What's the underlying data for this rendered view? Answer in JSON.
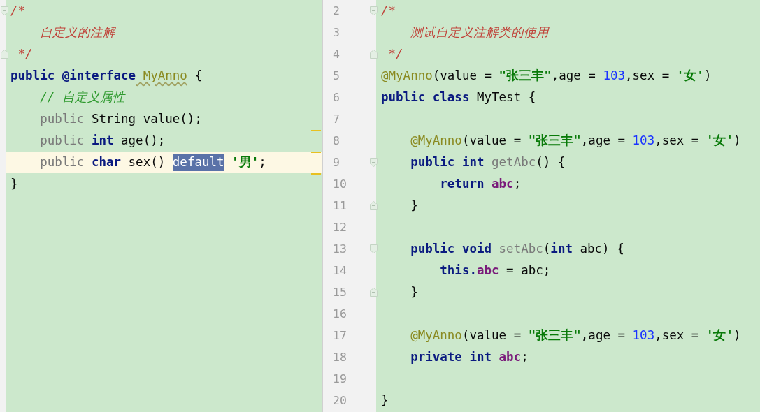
{
  "panes": [
    {
      "lines": [
        {
          "fold_start": true,
          "fold_end": false,
          "marker": false,
          "current": false,
          "tokens": [
            {
              "kind": "comment",
              "t": "/*"
            }
          ]
        },
        {
          "fold_start": false,
          "fold_end": false,
          "marker": false,
          "current": false,
          "tokens": [
            {
              "kind": "comment",
              "t": "    自定义的注解"
            }
          ]
        },
        {
          "fold_start": false,
          "fold_end": true,
          "marker": false,
          "current": false,
          "tokens": [
            {
              "kind": "comment",
              "t": " */"
            }
          ]
        },
        {
          "fold_start": false,
          "fold_end": false,
          "marker": false,
          "current": false,
          "tokens": [
            {
              "kind": "keyword",
              "t": "public"
            },
            {
              "kind": "keyword",
              "t": " @interface"
            },
            {
              "kind": "declared",
              "t": " MyAnno"
            },
            {
              "kind": "plain",
              "t": " {"
            }
          ]
        },
        {
          "fold_start": false,
          "fold_end": false,
          "marker": false,
          "current": false,
          "tokens": [
            {
              "kind": "line-comment",
              "t": "    // 自定义属性"
            }
          ]
        },
        {
          "fold_start": false,
          "fold_end": false,
          "marker": true,
          "current": false,
          "tokens": [
            {
              "kind": "dim",
              "t": "    public"
            },
            {
              "kind": "plain",
              "t": " String value();"
            }
          ]
        },
        {
          "fold_start": false,
          "fold_end": false,
          "marker": true,
          "current": false,
          "tokens": [
            {
              "kind": "dim",
              "t": "    public"
            },
            {
              "kind": "keyword",
              "t": " int"
            },
            {
              "kind": "plain",
              "t": " age();"
            }
          ]
        },
        {
          "fold_start": false,
          "fold_end": false,
          "marker": true,
          "current": true,
          "tokens": [
            {
              "kind": "dim",
              "t": "    public"
            },
            {
              "kind": "keyword",
              "t": " char"
            },
            {
              "kind": "plain",
              "t": " sex() "
            },
            {
              "kind": "selection",
              "t": "default"
            },
            {
              "kind": "string",
              "t": " '男'"
            },
            {
              "kind": "plain",
              "t": ";"
            }
          ]
        },
        {
          "fold_start": false,
          "fold_end": false,
          "marker": false,
          "current": false,
          "tokens": [
            {
              "kind": "plain",
              "t": "}"
            }
          ]
        }
      ]
    },
    {
      "lines": [
        {
          "number": "2",
          "fold_start": true,
          "fold_end": false,
          "tokens": [
            {
              "kind": "comment",
              "t": "/*"
            }
          ]
        },
        {
          "number": "3",
          "fold_start": false,
          "fold_end": false,
          "tokens": [
            {
              "kind": "comment",
              "t": "    测试自定义注解类的使用"
            }
          ]
        },
        {
          "number": "4",
          "fold_start": false,
          "fold_end": true,
          "tokens": [
            {
              "kind": "comment",
              "t": " */"
            }
          ]
        },
        {
          "number": "5",
          "fold_start": false,
          "fold_end": false,
          "tokens": [
            {
              "kind": "annotation",
              "t": "@MyAnno"
            },
            {
              "kind": "plain",
              "t": "(value = "
            },
            {
              "kind": "string",
              "t": "\"张三丰\""
            },
            {
              "kind": "plain",
              "t": ",age = "
            },
            {
              "kind": "number",
              "t": "103"
            },
            {
              "kind": "plain",
              "t": ",sex = "
            },
            {
              "kind": "string",
              "t": "'女'"
            },
            {
              "kind": "plain",
              "t": ")"
            }
          ]
        },
        {
          "number": "6",
          "fold_start": false,
          "fold_end": false,
          "tokens": [
            {
              "kind": "keyword",
              "t": "public class"
            },
            {
              "kind": "plain",
              "t": " MyTest {"
            }
          ]
        },
        {
          "number": "7",
          "fold_start": false,
          "fold_end": false
        },
        {
          "number": "8",
          "fold_start": false,
          "fold_end": false,
          "tokens": [
            {
              "kind": "annotation",
              "t": "    @MyAnno"
            },
            {
              "kind": "plain",
              "t": "(value = "
            },
            {
              "kind": "string",
              "t": "\"张三丰\""
            },
            {
              "kind": "plain",
              "t": ",age = "
            },
            {
              "kind": "number",
              "t": "103"
            },
            {
              "kind": "plain",
              "t": ",sex = "
            },
            {
              "kind": "string",
              "t": "'女'"
            },
            {
              "kind": "plain",
              "t": ")"
            }
          ]
        },
        {
          "number": "9",
          "fold_start": true,
          "fold_end": false,
          "tokens": [
            {
              "kind": "keyword",
              "t": "    public int"
            },
            {
              "kind": "dim",
              "t": " getAbc"
            },
            {
              "kind": "plain",
              "t": "() {"
            }
          ]
        },
        {
          "number": "10",
          "fold_start": false,
          "fold_end": false,
          "tokens": [
            {
              "kind": "keyword",
              "t": "        return"
            },
            {
              "kind": "field",
              "t": " abc"
            },
            {
              "kind": "plain",
              "t": ";"
            }
          ]
        },
        {
          "number": "11",
          "fold_start": false,
          "fold_end": true,
          "tokens": [
            {
              "kind": "plain",
              "t": "    }"
            }
          ]
        },
        {
          "number": "12",
          "fold_start": false,
          "fold_end": false
        },
        {
          "number": "13",
          "fold_start": true,
          "fold_end": false,
          "tokens": [
            {
              "kind": "keyword",
              "t": "    public void"
            },
            {
              "kind": "dim",
              "t": " setAbc"
            },
            {
              "kind": "plain",
              "t": "("
            },
            {
              "kind": "keyword",
              "t": "int"
            },
            {
              "kind": "plain",
              "t": " abc) {"
            }
          ]
        },
        {
          "number": "14",
          "fold_start": false,
          "fold_end": false,
          "tokens": [
            {
              "kind": "keyword",
              "t": "        this."
            },
            {
              "kind": "field",
              "t": "abc"
            },
            {
              "kind": "plain",
              "t": " = abc;"
            }
          ]
        },
        {
          "number": "15",
          "fold_start": false,
          "fold_end": true,
          "tokens": [
            {
              "kind": "plain",
              "t": "    }"
            }
          ]
        },
        {
          "number": "16",
          "fold_start": false,
          "fold_end": false
        },
        {
          "number": "17",
          "fold_start": false,
          "fold_end": false,
          "tokens": [
            {
              "kind": "annotation",
              "t": "    @MyAnno"
            },
            {
              "kind": "plain",
              "t": "(value = "
            },
            {
              "kind": "string",
              "t": "\"张三丰\""
            },
            {
              "kind": "plain",
              "t": ",age = "
            },
            {
              "kind": "number",
              "t": "103"
            },
            {
              "kind": "plain",
              "t": ",sex = "
            },
            {
              "kind": "string",
              "t": "'女'"
            },
            {
              "kind": "plain",
              "t": ")"
            }
          ]
        },
        {
          "number": "18",
          "fold_start": false,
          "fold_end": false,
          "tokens": [
            {
              "kind": "keyword",
              "t": "    private int"
            },
            {
              "kind": "field",
              "t": " abc"
            },
            {
              "kind": "plain",
              "t": ";"
            }
          ]
        },
        {
          "number": "19",
          "fold_start": false,
          "fold_end": false
        },
        {
          "number": "20",
          "fold_start": false,
          "fold_end": false,
          "tokens": [
            {
              "kind": "plain",
              "t": "}"
            }
          ]
        }
      ]
    }
  ]
}
